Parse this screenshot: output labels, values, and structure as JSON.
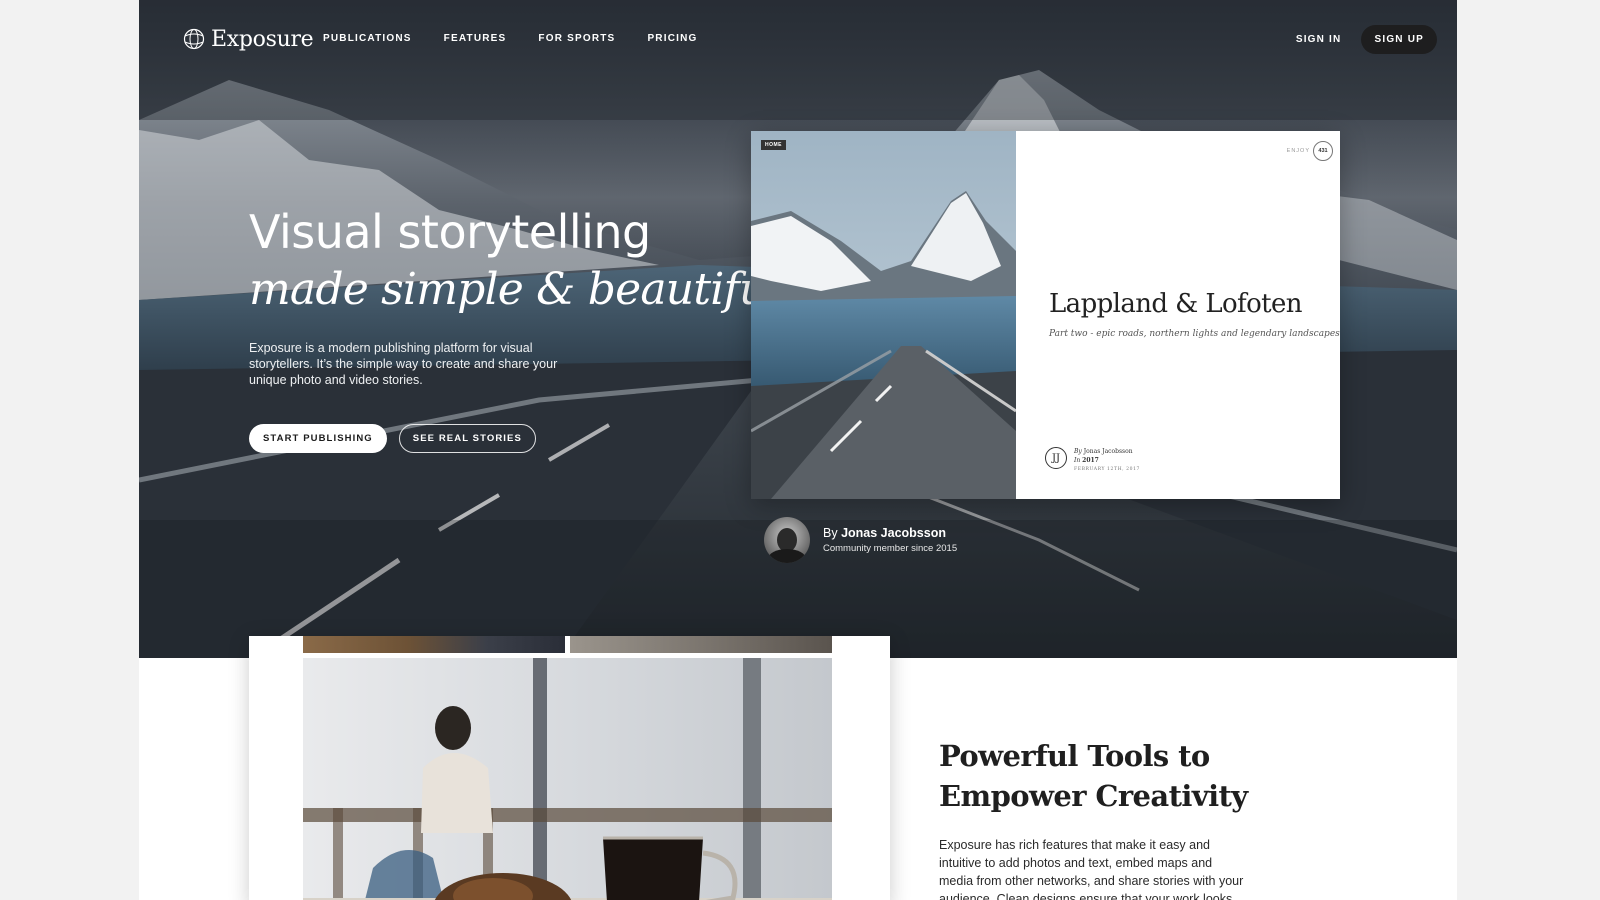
{
  "brand": {
    "name": "Exposure",
    "logo_icon": "globe-icon"
  },
  "nav": {
    "links": [
      "PUBLICATIONS",
      "FEATURES",
      "FOR SPORTS",
      "PRICING"
    ],
    "sign_in": "SIGN IN",
    "sign_up": "SIGN UP"
  },
  "hero": {
    "headline_line1": "Visual storytelling",
    "headline_line2": "made simple & beautiful",
    "description": "Exposure is a modern publishing platform for visual storytellers. It’s the simple way to create and share your unique photo and video stories.",
    "primary_button": "START PUBLISHING",
    "secondary_button": "SEE REAL STORIES"
  },
  "story_card": {
    "badge": "HOME",
    "enjoy_label": "ENJOY",
    "enjoy_count": "431",
    "title": "Lappland & Lofoten",
    "subtitle": "Part two - epic roads, northern lights and legendary landscapes",
    "monogram": "JJ",
    "author_by": "By",
    "author_name": "Jonas Jacobsson",
    "author_in": "In",
    "author_in_value": "2017",
    "date": "FEBRUARY 12TH, 2017"
  },
  "credit": {
    "by_prefix": "By",
    "name": "Jonas Jacobsson",
    "since": "Community member since 2015"
  },
  "features": {
    "title_line1": "Powerful Tools to",
    "title_line2": "Empower Creativity",
    "description": "Exposure has rich features that make it easy and intuitive to add photos and text, embed maps and media from other networks, and share stories with your audience. Clean designs ensure that your work looks"
  },
  "colors": {
    "signup_bg": "#1e1e1f",
    "page_bg": "#f2f2f2",
    "text_dark": "#1f1f1f"
  }
}
